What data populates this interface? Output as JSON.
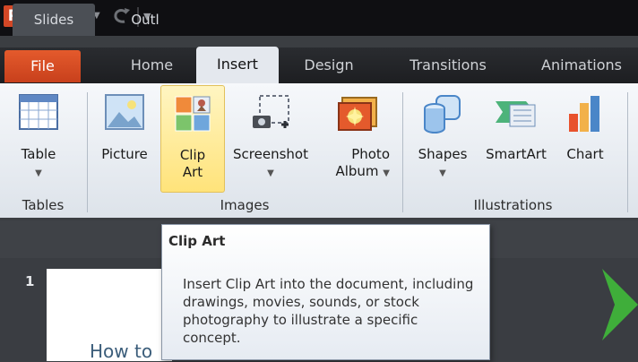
{
  "window": {
    "app_logo": "P",
    "qat": [
      {
        "icon": "save-icon"
      },
      {
        "icon": "undo-icon"
      },
      {
        "icon": "redo-icon"
      },
      {
        "icon": "customize-qat-icon"
      }
    ]
  },
  "tabs": [
    {
      "label": "File"
    },
    {
      "label": "Home"
    },
    {
      "label": "Insert"
    },
    {
      "label": "Design"
    },
    {
      "label": "Transitions"
    },
    {
      "label": "Animations"
    }
  ],
  "ribbon": {
    "groups": [
      {
        "label": "Tables",
        "buttons": [
          {
            "label_line1": "Table",
            "label_line2": "",
            "has_dropdown": true,
            "icon": "table-icon"
          }
        ]
      },
      {
        "label": "Images",
        "buttons": [
          {
            "label_line1": "Picture",
            "label_line2": "",
            "icon": "picture-icon"
          },
          {
            "label_line1": "Clip",
            "label_line2": "Art",
            "icon": "clip-art-icon",
            "highlighted": true
          },
          {
            "label_line1": "Screenshot",
            "label_line2": "",
            "has_dropdown": true,
            "icon": "screenshot-icon"
          },
          {
            "label_line1": "Photo",
            "label_line2": "Album",
            "has_dropdown": true,
            "icon": "photo-album-icon"
          }
        ]
      },
      {
        "label": "Illustrations",
        "buttons": [
          {
            "label_line1": "Shapes",
            "label_line2": "",
            "has_dropdown": true,
            "icon": "shapes-icon"
          },
          {
            "label_line1": "SmartArt",
            "label_line2": "",
            "icon": "smartart-icon"
          },
          {
            "label_line1": "Chart",
            "label_line2": "",
            "icon": "chart-icon"
          }
        ]
      }
    ]
  },
  "pane": {
    "tabs": [
      {
        "label": "Slides"
      },
      {
        "label": "Outl"
      }
    ]
  },
  "slide": {
    "number": "1",
    "thumb_text": "How to"
  },
  "tooltip": {
    "title": "Clip Art",
    "body": "Insert Clip Art into the document, including drawings, movies, sounds, or stock photography to illustrate a specific concept."
  },
  "colors": {
    "file_tab": "#d24726",
    "ribbon_bg": "#eef1f5",
    "tooltip_border": "#8a96a6"
  }
}
